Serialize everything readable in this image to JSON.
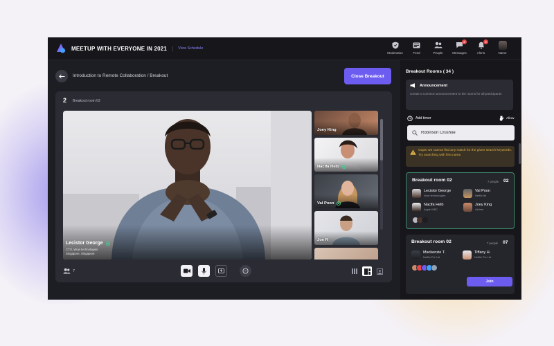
{
  "header": {
    "app_title": "MEETUP WITH EVERYONE IN 2021",
    "separator": "|",
    "schedule_link": "View Schedule",
    "nav": [
      {
        "label": "Moderation",
        "icon": "shield-icon"
      },
      {
        "label": "Feed",
        "icon": "feed-icon"
      },
      {
        "label": "People",
        "icon": "people-icon"
      },
      {
        "label": "Messages",
        "icon": "messages-icon",
        "badge": "2"
      },
      {
        "label": "Alerts",
        "icon": "bell-icon",
        "badge": "2"
      },
      {
        "label": "Name",
        "icon": "user-avatar"
      }
    ]
  },
  "main": {
    "breadcrumb": "Introduction to Remote Collaboration / Breakout",
    "close_breakout_label": "Close Breakout",
    "room_number": "2",
    "room_name": "Breakout room 02",
    "speaker": {
      "name": "Lecistor George",
      "role_line1": "CTO, Wow technologies",
      "role_line2": "Singapore, Singapore"
    },
    "thumbnails": [
      {
        "name": "Joey King"
      },
      {
        "name": "Nacifa Helb"
      },
      {
        "name": "Val Poon"
      },
      {
        "name": "Joe R"
      }
    ],
    "participant_count": "7",
    "controls": [
      "video-icon",
      "mic-icon",
      "share-screen-icon",
      "chat-icon"
    ],
    "layouts": [
      "grid-layout-icon",
      "speaker-layout-icon",
      "spotlight-layout-icon"
    ]
  },
  "panel": {
    "title": "Breakout Rooms ( 34 )",
    "announcement": {
      "title": "Announcement",
      "placeholder": "Create a common announcement to the rooms for all participants"
    },
    "add_timer_label": "Add timer",
    "allow_label": "Allow",
    "search_value": "Robinson Crushoe",
    "warning": "Oops! we cannot find any match for the given search keywords. Try searching with first name.",
    "rooms": [
      {
        "title": "Breakout room 02",
        "count_label": "7 people",
        "num": "02",
        "members": [
          {
            "name": "Lecistor George",
            "org": "Wow technologies"
          },
          {
            "name": "Val Poon",
            "org": "Netflix Itd"
          },
          {
            "name": "Nacifa Helb",
            "org": "Apple WBC"
          },
          {
            "name": "Joey King",
            "org": "Airtime"
          }
        ]
      },
      {
        "title": "Breakout room 02",
        "count_label": "7 people",
        "num": "07",
        "members": [
          {
            "name": "Mackenzie T.",
            "org": "Netflix Pvt Ltd"
          },
          {
            "name": "Tiffany H.",
            "org": "Netflix Pvt Ltd"
          }
        ],
        "join_label": "Join"
      }
    ]
  },
  "colors": {
    "accent": "#6d5cf0",
    "online": "#3ecf8e",
    "warning": "#e0b24a",
    "badge": "#e8474a"
  }
}
